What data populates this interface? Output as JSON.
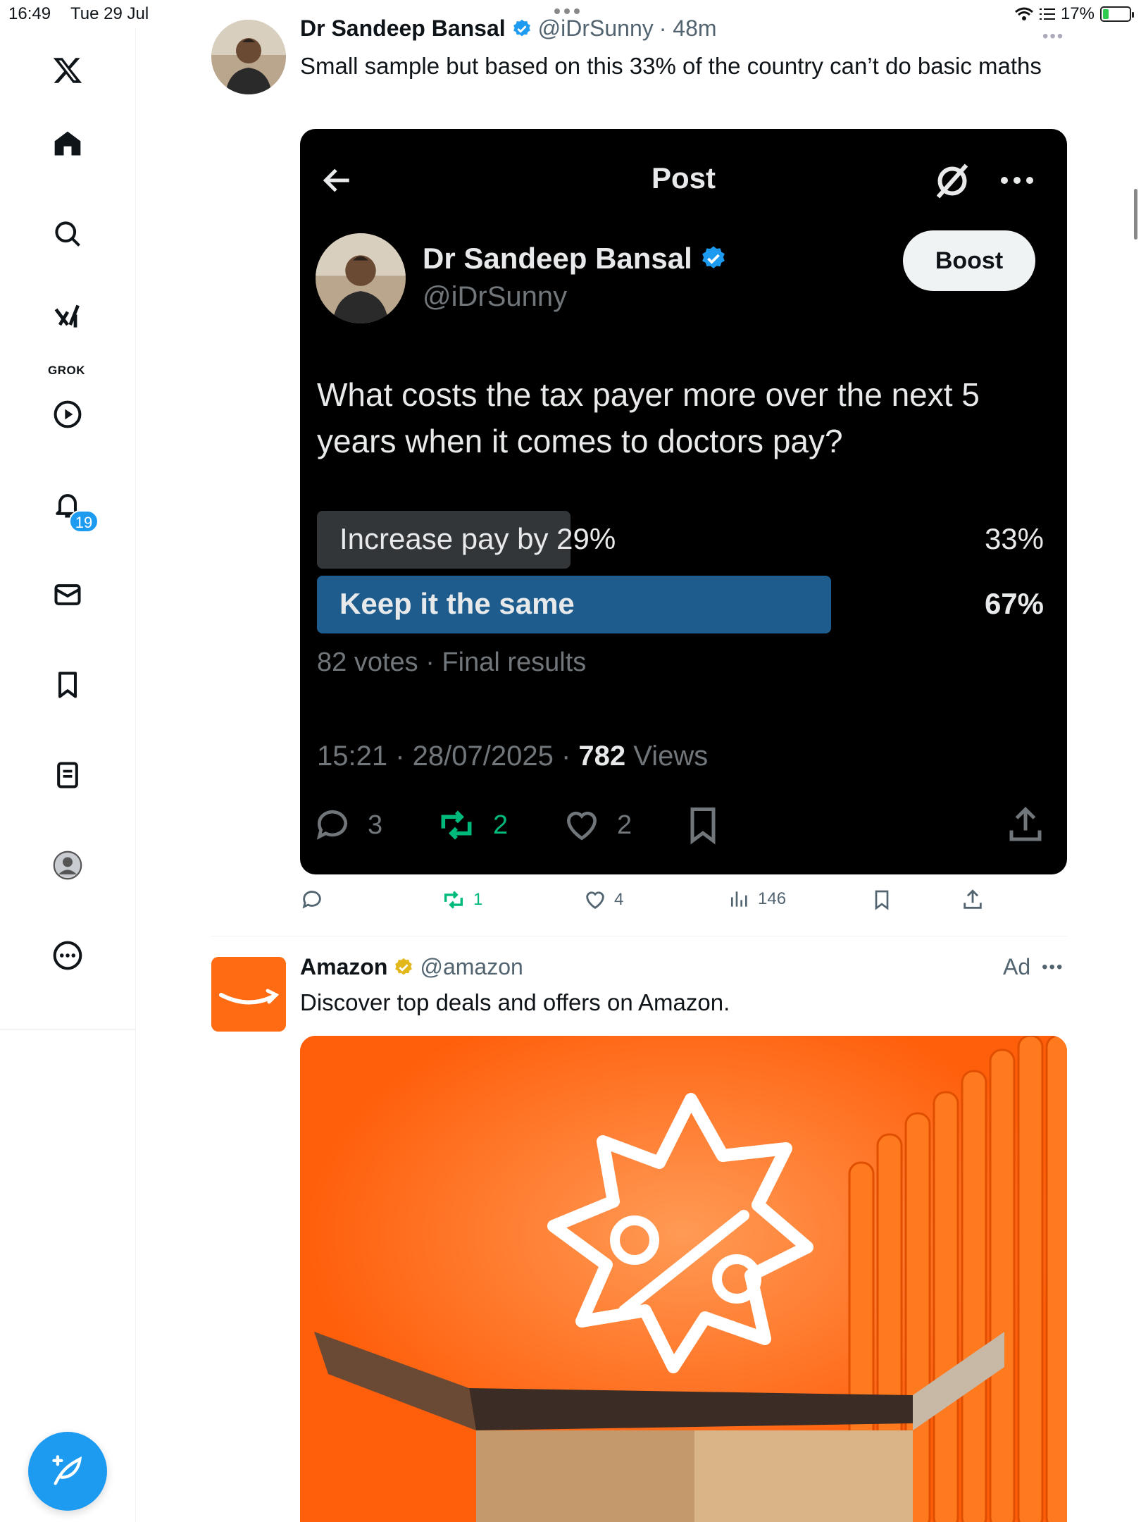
{
  "status_bar": {
    "time": "16:49",
    "date": "Tue 29 Jul",
    "battery": "17%"
  },
  "sidebar": {
    "notification_count": "19",
    "grok_label": "GROK"
  },
  "tweet": {
    "name": "Dr Sandeep Bansal",
    "handle": "@iDrSunny",
    "age": "· 48m",
    "text": "Small sample but based on this 33% of the country can’t do basic maths",
    "embed": {
      "title": "Post",
      "name": "Dr Sandeep Bansal",
      "handle": "@iDrSunny",
      "boost_label": "Boost",
      "question": "What costs the tax payer more over the next 5 years when it comes to doctors pay?",
      "poll": [
        {
          "label": "Increase pay by 29%",
          "percent": "33%",
          "fraction": 0.33,
          "winner": false
        },
        {
          "label": "Keep it the same",
          "percent": "67%",
          "fraction": 0.67,
          "winner": true
        }
      ],
      "votes": "82 votes · Final results",
      "timestamp": "15:21 · 28/07/2025 · ",
      "views_count": "782",
      "views_label": " Views",
      "replies": "3",
      "reposts": "2",
      "likes": "2"
    },
    "actions": {
      "reposts": "1",
      "likes": "4",
      "views": "146"
    }
  },
  "ad": {
    "name": "Amazon",
    "handle": "@amazon",
    "ad_label": "Ad",
    "text": "Discover top deals and offers on Amazon."
  },
  "colors": {
    "accent": "#1d9bf0",
    "repost_green": "#00ba7c",
    "poll_winner": "#1d5c8c",
    "poll_other": "#333639",
    "amazon_orange": "#ff6b12"
  }
}
